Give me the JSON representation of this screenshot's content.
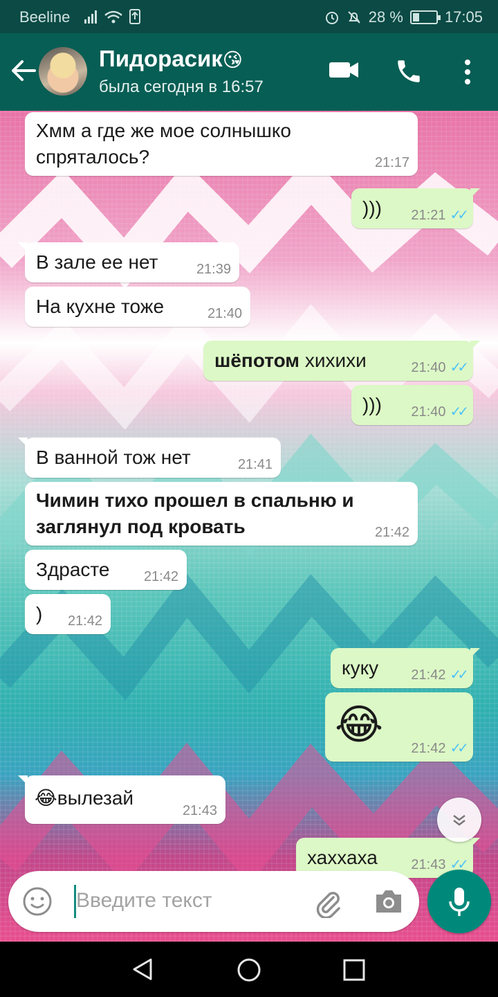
{
  "status_bar": {
    "carrier": "Beeline",
    "battery": "28 %",
    "time": "17:05"
  },
  "header": {
    "contact_name": "Пидорасик",
    "contact_emoji": "😘",
    "last_seen": "была сегодня в 16:57"
  },
  "messages": [
    {
      "dir": "in",
      "text": "Хмм а где же мое солнышко спряталось?",
      "time": "21:17"
    },
    {
      "dir": "out",
      "text": ")))",
      "time": "21:21"
    },
    {
      "dir": "in",
      "text": "В зале ее нет",
      "time": "21:39"
    },
    {
      "dir": "in",
      "text": "На кухне тоже",
      "time": "21:40"
    },
    {
      "dir": "out",
      "bold_part": "шёпотом",
      "text": "хихихи",
      "time": "21:40"
    },
    {
      "dir": "out",
      "text": ")))",
      "time": "21:40"
    },
    {
      "dir": "in",
      "text": "В ванной тож нет",
      "time": "21:41"
    },
    {
      "dir": "in",
      "text": "Чимин тихо прошел в спальню и заглянул под кровать",
      "time": "21:42",
      "bold": true
    },
    {
      "dir": "in",
      "text": "Здрасте",
      "time": "21:42"
    },
    {
      "dir": "in",
      "text": ")",
      "time": "21:42"
    },
    {
      "dir": "out",
      "text": "куку",
      "time": "21:42"
    },
    {
      "dir": "out",
      "text": "😂",
      "time": "21:42"
    },
    {
      "dir": "in",
      "text": "😂вылезай",
      "time": "21:43"
    },
    {
      "dir": "out",
      "text": "хаххаха",
      "time": "21:43"
    }
  ],
  "input": {
    "placeholder": "Введите текст"
  },
  "colors": {
    "header": "#075e54",
    "status_bar": "#0b4a45",
    "outgoing_bubble": "#dcf8c6",
    "incoming_bubble": "#ffffff",
    "read_ticks": "#4fc3f7",
    "mic_button": "#00897b"
  },
  "icons": [
    "back-arrow-icon",
    "video-call-icon",
    "phone-icon",
    "more-vert-icon",
    "emoji-icon",
    "attach-icon",
    "camera-icon",
    "mic-icon",
    "chevron-down-icon",
    "nav-back-icon",
    "nav-home-icon",
    "nav-recents-icon"
  ]
}
